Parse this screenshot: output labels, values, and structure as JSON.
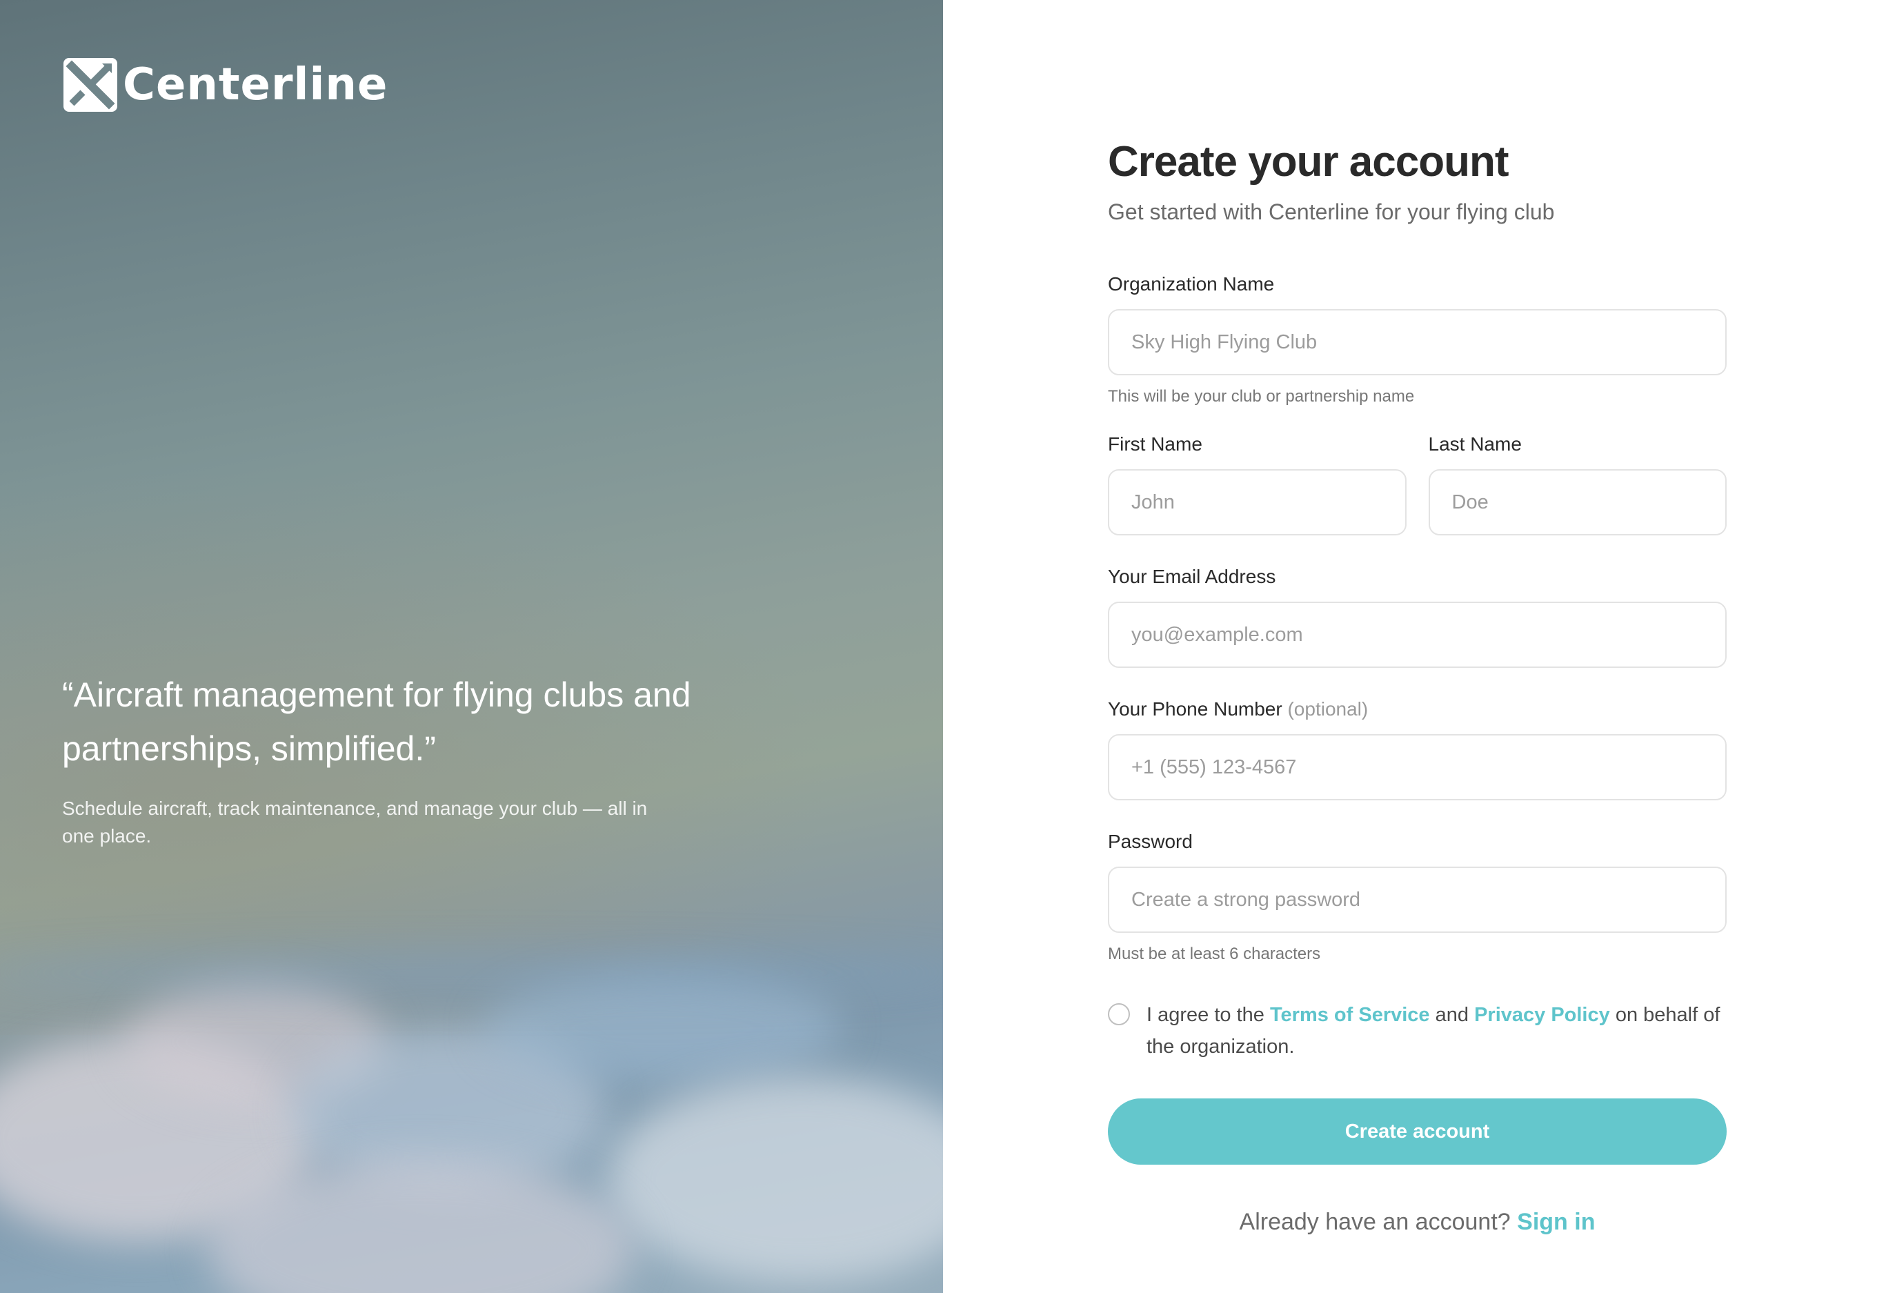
{
  "hero": {
    "brand": "Centerline",
    "quote": "“Aircraft management for flying clubs and partnerships, simplified.”",
    "subtext": "Schedule aircraft, track maintenance, and manage your club — all in one place."
  },
  "form": {
    "title": "Create your account",
    "subtitle": "Get started with Centerline for your flying club",
    "organization": {
      "label": "Organization Name",
      "placeholder": "Sky High Flying Club",
      "hint": "This will be your club or partnership name"
    },
    "first_name": {
      "label": "First Name",
      "placeholder": "John"
    },
    "last_name": {
      "label": "Last Name",
      "placeholder": "Doe"
    },
    "email": {
      "label": "Your Email Address",
      "placeholder": "you@example.com"
    },
    "phone": {
      "label": "Your Phone Number",
      "optional": "(optional)",
      "placeholder": "+1 (555) 123-4567"
    },
    "password": {
      "label": "Password",
      "placeholder": "Create a strong password",
      "hint": "Must be at least 6 characters"
    },
    "agree": {
      "prefix": "I agree to the",
      "terms": "Terms of Service",
      "and": "and",
      "privacy": "Privacy Policy",
      "suffix": "on behalf of the organization."
    },
    "submit_label": "Create account",
    "signin_prompt": "Already have an account?",
    "signin_link": "Sign in"
  },
  "colors": {
    "accent": "#64c7cc",
    "link": "#5ec4cb",
    "heading": "#2a2a2a"
  }
}
